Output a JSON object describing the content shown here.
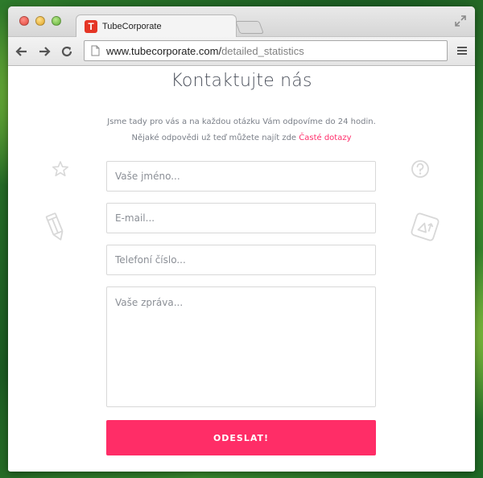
{
  "browser": {
    "tab_title": "TubeCorporate",
    "favicon_letter": "T",
    "url_host": "www.tubecorporate.com/",
    "url_path": "detailed_statistics"
  },
  "page": {
    "heading": "Kontaktujte nás",
    "subtext_line1": "Jsme tady pro vás a na každou otázku Vám odpovíme do 24 hodin.",
    "subtext_line2_prefix": "Nějaké odpovědi už teď můžete najít zde ",
    "faq_link": "Časté dotazy"
  },
  "form": {
    "name_placeholder": "Vaše jméno...",
    "email_placeholder": "E-mail...",
    "phone_placeholder": "Telefoní číslo...",
    "message_placeholder": "Vaše zpráva...",
    "submit_label": "ODESLAT!"
  },
  "colors": {
    "accent": "#ff2d67",
    "heading": "#4a4f5a"
  },
  "icons": [
    "star-icon",
    "pencil-icon",
    "question-icon",
    "dice-icon"
  ]
}
